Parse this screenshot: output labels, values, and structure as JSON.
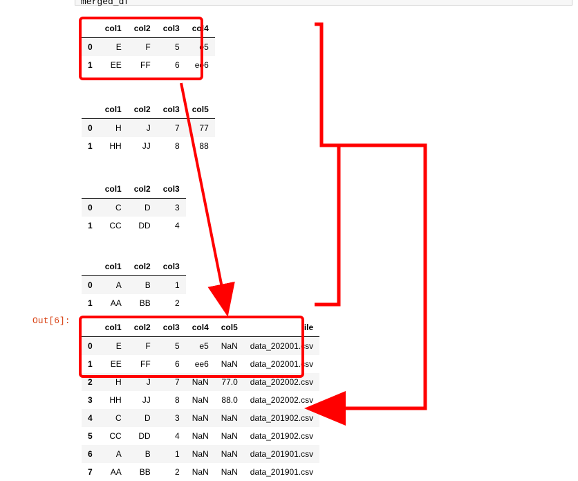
{
  "topbar": {
    "text": "merged_df"
  },
  "out_prompt": "Out[6]:",
  "tables": {
    "t1": {
      "headers": [
        "",
        "col1",
        "col2",
        "col3",
        "col4"
      ],
      "rows": [
        [
          "0",
          "E",
          "F",
          "5",
          "e5"
        ],
        [
          "1",
          "EE",
          "FF",
          "6",
          "ee6"
        ]
      ]
    },
    "t2": {
      "headers": [
        "",
        "col1",
        "col2",
        "col3",
        "col5"
      ],
      "rows": [
        [
          "0",
          "H",
          "J",
          "7",
          "77"
        ],
        [
          "1",
          "HH",
          "JJ",
          "8",
          "88"
        ]
      ]
    },
    "t3": {
      "headers": [
        "",
        "col1",
        "col2",
        "col3"
      ],
      "rows": [
        [
          "0",
          "C",
          "D",
          "3"
        ],
        [
          "1",
          "CC",
          "DD",
          "4"
        ]
      ]
    },
    "t4": {
      "headers": [
        "",
        "col1",
        "col2",
        "col3"
      ],
      "rows": [
        [
          "0",
          "A",
          "B",
          "1"
        ],
        [
          "1",
          "AA",
          "BB",
          "2"
        ]
      ]
    },
    "t5": {
      "headers": [
        "",
        "col1",
        "col2",
        "col3",
        "col4",
        "col5",
        "file"
      ],
      "rows": [
        [
          "0",
          "E",
          "F",
          "5",
          "e5",
          "NaN",
          "data_202001.csv"
        ],
        [
          "1",
          "EE",
          "FF",
          "6",
          "ee6",
          "NaN",
          "data_202001.csv"
        ],
        [
          "2",
          "H",
          "J",
          "7",
          "NaN",
          "77.0",
          "data_202002.csv"
        ],
        [
          "3",
          "HH",
          "JJ",
          "8",
          "NaN",
          "88.0",
          "data_202002.csv"
        ],
        [
          "4",
          "C",
          "D",
          "3",
          "NaN",
          "NaN",
          "data_201902.csv"
        ],
        [
          "5",
          "CC",
          "DD",
          "4",
          "NaN",
          "NaN",
          "data_201902.csv"
        ],
        [
          "6",
          "A",
          "B",
          "1",
          "NaN",
          "NaN",
          "data_201901.csv"
        ],
        [
          "7",
          "AA",
          "BB",
          "2",
          "NaN",
          "NaN",
          "data_201901.csv"
        ]
      ]
    }
  }
}
